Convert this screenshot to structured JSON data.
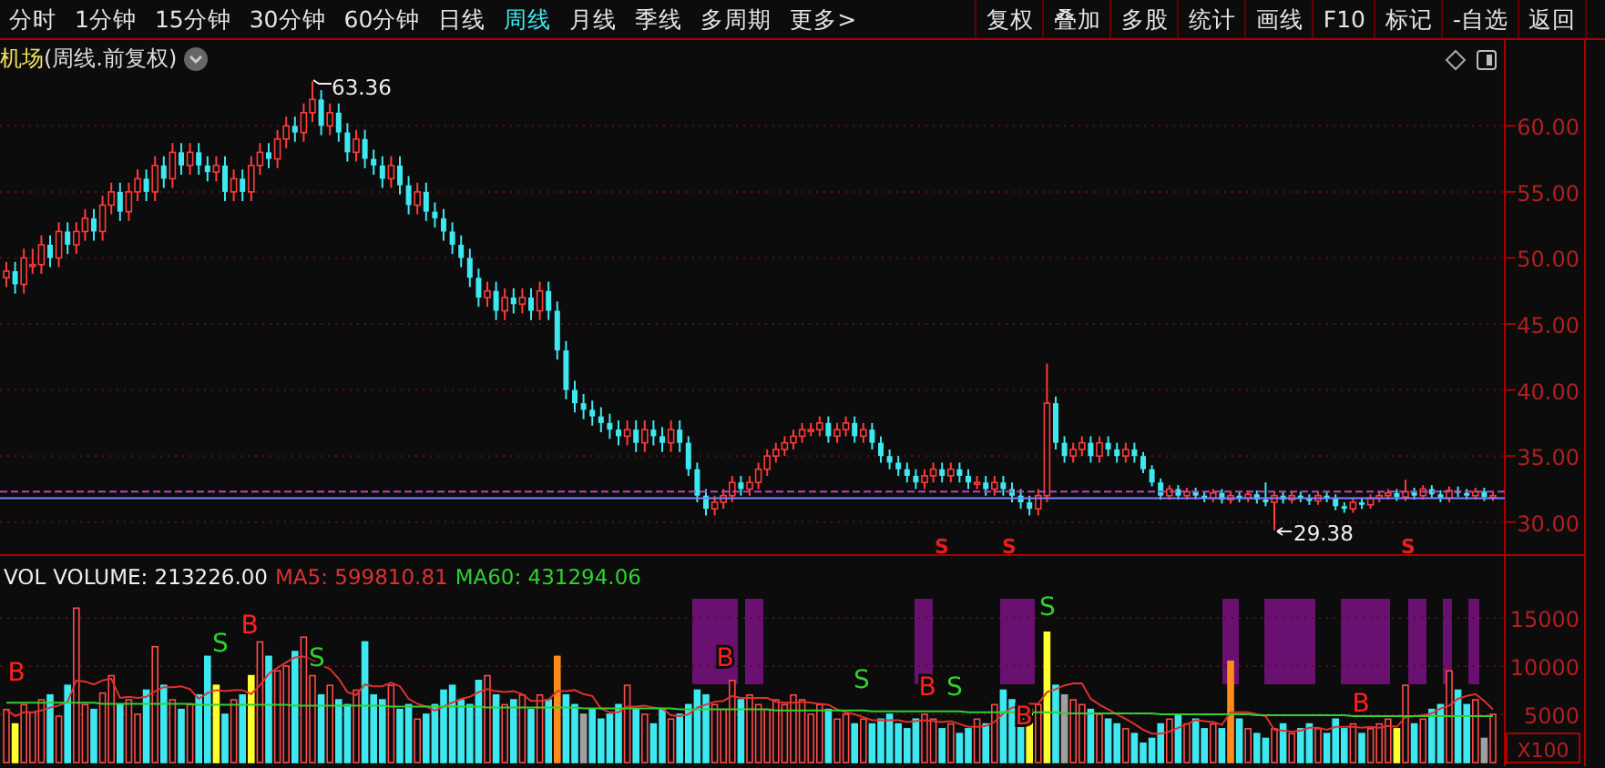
{
  "toolbar": {
    "periods": [
      {
        "label": "分时",
        "selected": false
      },
      {
        "label": "1分钟",
        "selected": false
      },
      {
        "label": "15分钟",
        "selected": false
      },
      {
        "label": "30分钟",
        "selected": false
      },
      {
        "label": "60分钟",
        "selected": false
      },
      {
        "label": "日线",
        "selected": false
      },
      {
        "label": "周线",
        "selected": true
      },
      {
        "label": "月线",
        "selected": false
      },
      {
        "label": "季线",
        "selected": false
      },
      {
        "label": "多周期",
        "selected": false
      },
      {
        "label": "更多>",
        "selected": false
      }
    ],
    "actions": [
      "复权",
      "叠加",
      "多股",
      "统计",
      "画线",
      "F10",
      "标记",
      "-自选",
      "返回"
    ]
  },
  "chart": {
    "stock_name": "机场",
    "period_label": "(周线.前复权)",
    "high_label": "63.36",
    "low_label": "29.38",
    "price_signals": [
      "S",
      "S",
      "S"
    ],
    "chart_data": {
      "type": "candlestick",
      "ylim": [
        27.5,
        66.5
      ],
      "grid": true,
      "yticks": [
        {
          "value": 60,
          "label": "60.00"
        },
        {
          "value": 55,
          "label": "55.00"
        },
        {
          "value": 50,
          "label": "50.00"
        },
        {
          "value": 45,
          "label": "45.00"
        },
        {
          "value": 40,
          "label": "40.00"
        },
        {
          "value": 35,
          "label": "35.00"
        },
        {
          "value": 30,
          "label": "30.00"
        }
      ],
      "ohlc": [
        [
          48.5,
          49.7,
          47.8,
          49
        ],
        [
          49,
          49.7,
          47.3,
          48
        ],
        [
          48,
          50.7,
          47.3,
          50
        ],
        [
          49.5,
          50.7,
          48.8,
          49.5
        ],
        [
          49.5,
          51.7,
          48.8,
          51
        ],
        [
          51,
          51.7,
          49.3,
          50
        ],
        [
          50,
          52.7,
          49.3,
          52
        ],
        [
          52,
          52.7,
          50.3,
          51
        ],
        [
          51,
          52.7,
          50.3,
          52
        ],
        [
          52,
          53.7,
          51.3,
          53
        ],
        [
          53,
          53.7,
          51.3,
          52
        ],
        [
          52,
          54.7,
          51.3,
          54
        ],
        [
          54,
          55.7,
          53.3,
          55
        ],
        [
          55,
          55.7,
          52.8,
          53.5
        ],
        [
          53.5,
          55.7,
          52.8,
          55
        ],
        [
          55,
          56.7,
          54.3,
          56
        ],
        [
          56,
          56.7,
          54.3,
          55
        ],
        [
          55,
          57.7,
          54.3,
          57
        ],
        [
          57,
          57.7,
          55.3,
          56
        ],
        [
          56,
          58.7,
          55.3,
          58
        ],
        [
          58,
          58.7,
          56.3,
          57
        ],
        [
          57,
          58.7,
          56.3,
          58
        ],
        [
          58,
          58.7,
          56.3,
          57
        ],
        [
          57,
          57.7,
          55.8,
          56.5
        ],
        [
          56.5,
          57.7,
          55.8,
          57
        ],
        [
          57,
          57.7,
          54.3,
          55
        ],
        [
          55,
          56.7,
          54.3,
          56
        ],
        [
          56,
          56.7,
          54.3,
          55
        ],
        [
          55,
          57.7,
          54.3,
          57
        ],
        [
          57,
          58.7,
          56.3,
          58
        ],
        [
          58,
          58.7,
          56.8,
          57.5
        ],
        [
          57.5,
          59.7,
          56.8,
          59
        ],
        [
          59,
          60.7,
          58.3,
          60
        ],
        [
          60,
          60.7,
          58.8,
          59.5
        ],
        [
          59.5,
          61.7,
          58.8,
          61
        ],
        [
          61,
          63.36,
          60.3,
          62
        ],
        [
          62,
          62.7,
          59.3,
          60
        ],
        [
          60,
          61.7,
          59.3,
          61
        ],
        [
          61,
          61.7,
          58.8,
          59.5
        ],
        [
          59.5,
          60.2,
          57.3,
          58
        ],
        [
          58,
          59.7,
          57.3,
          59
        ],
        [
          59,
          59.7,
          56.8,
          57.5
        ],
        [
          57.5,
          58.2,
          56.3,
          57
        ],
        [
          57,
          57.7,
          55.3,
          56
        ],
        [
          56,
          57.7,
          55.3,
          57
        ],
        [
          57,
          57.7,
          54.8,
          55.5
        ],
        [
          55.5,
          56.2,
          53.3,
          54
        ],
        [
          54,
          55.7,
          53.3,
          55
        ],
        [
          55,
          55.7,
          52.8,
          53.5
        ],
        [
          53.5,
          54.2,
          52.3,
          53
        ],
        [
          53,
          53.7,
          51.3,
          52
        ],
        [
          52,
          52.7,
          50.3,
          51
        ],
        [
          51,
          51.7,
          49.3,
          50
        ],
        [
          50,
          50.7,
          47.8,
          48.5
        ],
        [
          48.5,
          49.2,
          46.3,
          47
        ],
        [
          47,
          48.2,
          46.3,
          47.5
        ],
        [
          47.5,
          48.2,
          45.3,
          46
        ],
        [
          46,
          47.7,
          45.3,
          47
        ],
        [
          47,
          47.7,
          45.8,
          46.5
        ],
        [
          46.5,
          47.7,
          45.8,
          47
        ],
        [
          47,
          47.7,
          45.3,
          46
        ],
        [
          46,
          48.2,
          45.3,
          47.5
        ],
        [
          47.5,
          48.2,
          45.3,
          46
        ],
        [
          46,
          46.7,
          42.3,
          43
        ],
        [
          43,
          43.7,
          39.3,
          40
        ],
        [
          40,
          40.7,
          38.3,
          39
        ],
        [
          39,
          39.7,
          37.8,
          38.5
        ],
        [
          38.5,
          39.2,
          37.3,
          38
        ],
        [
          38,
          38.7,
          36.8,
          37.5
        ],
        [
          37.5,
          38.2,
          36.3,
          37
        ],
        [
          37,
          37.7,
          35.8,
          36.5
        ],
        [
          36.5,
          37.7,
          35.8,
          37
        ],
        [
          37,
          37.7,
          35.3,
          36
        ],
        [
          36,
          37.7,
          35.3,
          37
        ],
        [
          37,
          37.7,
          35.8,
          36.5
        ],
        [
          36.5,
          37.2,
          35.3,
          36
        ],
        [
          36,
          37.7,
          35.3,
          37
        ],
        [
          37,
          37.7,
          35.3,
          36
        ],
        [
          36,
          36.5,
          33.5,
          34
        ],
        [
          34,
          34.5,
          31.5,
          32
        ],
        [
          32,
          32.5,
          30.5,
          31
        ],
        [
          31,
          32,
          30.5,
          31.5
        ],
        [
          31.5,
          32.5,
          31,
          32
        ],
        [
          32,
          33.5,
          31.5,
          33
        ],
        [
          33,
          33.5,
          32,
          32.5
        ],
        [
          32.5,
          33.5,
          32,
          33
        ],
        [
          33,
          34.5,
          32.5,
          34
        ],
        [
          34,
          35.5,
          33.5,
          35
        ],
        [
          35,
          36,
          34.5,
          35.5
        ],
        [
          35.5,
          36.5,
          35,
          36
        ],
        [
          36,
          37,
          35.5,
          36.5
        ],
        [
          36.5,
          37.5,
          36,
          37
        ],
        [
          37,
          37.5,
          36.5,
          37
        ],
        [
          37,
          38,
          36.5,
          37.5
        ],
        [
          37.5,
          38,
          36,
          36.5
        ],
        [
          36.5,
          37.5,
          36,
          37
        ],
        [
          37,
          38,
          36.5,
          37.5
        ],
        [
          37.5,
          38,
          36,
          36.5
        ],
        [
          36.5,
          37.5,
          36,
          37
        ],
        [
          37,
          37.5,
          35.5,
          36
        ],
        [
          36,
          36.5,
          34.5,
          35
        ],
        [
          35,
          35.5,
          34,
          34.5
        ],
        [
          34.5,
          35,
          33.5,
          34
        ],
        [
          34,
          34.5,
          33,
          33.5
        ],
        [
          33.5,
          34,
          32.5,
          33
        ],
        [
          33,
          34,
          32.5,
          33.5
        ],
        [
          33.5,
          34.5,
          33,
          34
        ],
        [
          34,
          34.5,
          33,
          33.5
        ],
        [
          33.5,
          34.5,
          33,
          34
        ],
        [
          34,
          34.5,
          33,
          33.5
        ],
        [
          33.5,
          34,
          32.5,
          33
        ],
        [
          33,
          33.5,
          32.5,
          33
        ],
        [
          33,
          33.5,
          32,
          32.5
        ],
        [
          32.5,
          33.5,
          32,
          33
        ],
        [
          33,
          33.5,
          32,
          32.5
        ],
        [
          32.5,
          33,
          31.5,
          32
        ],
        [
          32,
          32.5,
          31,
          31.5
        ],
        [
          31.5,
          32,
          30.5,
          31
        ],
        [
          31,
          32.5,
          30.5,
          32
        ],
        [
          32,
          42,
          31.5,
          39
        ],
        [
          39,
          39.5,
          35.5,
          36
        ],
        [
          36,
          36.5,
          34.5,
          35
        ],
        [
          35,
          36,
          34.5,
          35.5
        ],
        [
          35.5,
          36.5,
          35,
          36
        ],
        [
          36,
          36.5,
          34.5,
          35
        ],
        [
          35,
          36.5,
          34.5,
          36
        ],
        [
          36,
          36.5,
          35,
          35.5
        ],
        [
          35.5,
          36,
          34.5,
          35
        ],
        [
          35,
          36,
          34.5,
          35.5
        ],
        [
          35.5,
          36,
          34.5,
          35
        ],
        [
          35,
          35.3,
          33.7,
          34
        ],
        [
          34,
          34.3,
          32.7,
          33
        ],
        [
          33,
          33.3,
          31.7,
          32
        ],
        [
          32,
          32.8,
          31.7,
          32.5
        ],
        [
          32.5,
          32.8,
          31.7,
          32
        ],
        [
          32,
          32.6,
          31.7,
          32.3
        ],
        [
          32.3,
          32.6,
          31.7,
          32
        ],
        [
          32,
          32.3,
          31.5,
          31.8
        ],
        [
          31.8,
          32.5,
          31.5,
          32.2
        ],
        [
          32.2,
          32.5,
          31.4,
          31.7
        ],
        [
          31.7,
          32.3,
          31.4,
          32
        ],
        [
          32,
          32.3,
          31.5,
          31.8
        ],
        [
          31.8,
          32.4,
          31.5,
          32.1
        ],
        [
          32.1,
          32.4,
          31.4,
          31.7
        ],
        [
          31.7,
          33,
          31.2,
          31.5
        ],
        [
          31.5,
          32.3,
          29.38,
          32
        ],
        [
          32,
          32.3,
          31.4,
          31.7
        ],
        [
          31.7,
          32.3,
          31.4,
          32
        ],
        [
          32,
          32.3,
          31.5,
          31.8
        ],
        [
          31.8,
          32.1,
          31.3,
          31.6
        ],
        [
          31.6,
          32.3,
          31.3,
          32
        ],
        [
          32,
          32.3,
          31.5,
          31.8
        ],
        [
          31.8,
          32.1,
          30.9,
          31.2
        ],
        [
          31.2,
          31.5,
          30.7,
          31
        ],
        [
          31,
          31.8,
          30.7,
          31.5
        ],
        [
          31.5,
          31.8,
          31,
          31.3
        ],
        [
          31.3,
          32.1,
          31,
          31.8
        ],
        [
          31.8,
          32.3,
          31.5,
          32
        ],
        [
          32,
          32.5,
          31.7,
          32.2
        ],
        [
          32.2,
          32.5,
          31.6,
          31.9
        ],
        [
          31.9,
          33.2,
          31.6,
          32.3
        ],
        [
          32.3,
          32.6,
          31.7,
          32
        ],
        [
          32,
          32.8,
          31.7,
          32.5
        ],
        [
          32.5,
          32.8,
          31.8,
          32.1
        ],
        [
          32.1,
          32.4,
          31.5,
          31.8
        ],
        [
          31.8,
          32.7,
          31.5,
          32.4
        ],
        [
          32.4,
          32.7,
          31.9,
          32.2
        ],
        [
          32.2,
          32.5,
          31.7,
          32
        ],
        [
          32,
          32.6,
          31.7,
          32.3
        ],
        [
          32.3,
          32.6,
          31.6,
          31.9
        ],
        [
          31.9,
          32.3,
          31.6,
          32
        ]
      ]
    }
  },
  "volume": {
    "indicator": "VOL",
    "readouts": [
      ": 213226.00",
      ": 599810.81",
      ": 431294.06"
    ],
    "unit": "X100",
    "chart_data": {
      "type": "bar",
      "ylim": [
        0,
        21500
      ],
      "grid": true,
      "stacked": false,
      "yticks": [
        {
          "value": 15000,
          "label": "15000"
        },
        {
          "value": 10000,
          "label": "10000"
        },
        {
          "value": 5000,
          "label": "5000"
        }
      ],
      "series": [
        {
          "name": "VOLUME",
          "type": "bar",
          "colors": [
            "#ff4a4a",
            "#ffff30",
            "#ff4a4a",
            "#ff4a4a",
            "#ff4a4a",
            "#3ee8f0",
            "#ff4a4a",
            "#3ee8f0",
            "#ff4a4a",
            "#ff4a4a",
            "#3ee8f0",
            "#ff4a4a",
            "#ff4a4a",
            "#3ee8f0",
            "#ff4a4a",
            "#ff4a4a",
            "#3ee8f0",
            "#ff4a4a",
            "#3ee8f0",
            "#ff4a4a",
            "#3ee8f0",
            "#ff4a4a",
            "#3ee8f0",
            "#3ee8f0",
            "#ffff30",
            "#3ee8f0",
            "#ff4a4a",
            "#3ee8f0",
            "#ffff30",
            "#ff4a4a",
            "#3ee8f0",
            "#ff4a4a",
            "#ff4a4a",
            "#3ee8f0",
            "#ff4a4a",
            "#ff4a4a",
            "#3ee8f0",
            "#ff4a4a",
            "#3ee8f0",
            "#3ee8f0",
            "#ff4a4a",
            "#3ee8f0",
            "#3ee8f0",
            "#3ee8f0",
            "#ff4a4a",
            "#3ee8f0",
            "#3ee8f0",
            "#ff4a4a",
            "#3ee8f0",
            "#3ee8f0",
            "#3ee8f0",
            "#3ee8f0",
            "#3ee8f0",
            "#3ee8f0",
            "#3ee8f0",
            "#ff4a4a",
            "#3ee8f0",
            "#ff4a4a",
            "#3ee8f0",
            "#ff4a4a",
            "#3ee8f0",
            "#ff4a4a",
            "#3ee8f0",
            "#ff8c1a",
            "#3ee8f0",
            "#3ee8f0",
            "#a0a0a0",
            "#3ee8f0",
            "#3ee8f0",
            "#3ee8f0",
            "#3ee8f0",
            "#ff4a4a",
            "#3ee8f0",
            "#ff4a4a",
            "#3ee8f0",
            "#3ee8f0",
            "#ff4a4a",
            "#3ee8f0",
            "#3ee8f0",
            "#3ee8f0",
            "#3ee8f0",
            "#ff4a4a",
            "#ff4a4a",
            "#ff4a4a",
            "#3ee8f0",
            "#ff4a4a",
            "#ff4a4a",
            "#ff4a4a",
            "#ff4a4a",
            "#ff4a4a",
            "#ff4a4a",
            "#ff4a4a",
            "#ff4a4a",
            "#ff4a4a",
            "#3ee8f0",
            "#ff4a4a",
            "#ff4a4a",
            "#3ee8f0",
            "#ff4a4a",
            "#3ee8f0",
            "#3ee8f0",
            "#3ee8f0",
            "#3ee8f0",
            "#3ee8f0",
            "#3ee8f0",
            "#ff4a4a",
            "#ff4a4a",
            "#3ee8f0",
            "#ff4a4a",
            "#3ee8f0",
            "#3ee8f0",
            "#ff4a4a",
            "#3ee8f0",
            "#ff4a4a",
            "#3ee8f0",
            "#3ee8f0",
            "#3ee8f0",
            "#ffff30",
            "#ff4a4a",
            "#ffff30",
            "#3ee8f0",
            "#a0a0a0",
            "#ff4a4a",
            "#ff4a4a",
            "#3ee8f0",
            "#ff4a4a",
            "#3ee8f0",
            "#3ee8f0",
            "#ff4a4a",
            "#3ee8f0",
            "#3ee8f0",
            "#3ee8f0",
            "#3ee8f0",
            "#ff4a4a",
            "#3ee8f0",
            "#ff4a4a",
            "#3ee8f0",
            "#3ee8f0",
            "#ff4a4a",
            "#3ee8f0",
            "#ff8c1a",
            "#3ee8f0",
            "#ff4a4a",
            "#3ee8f0",
            "#3ee8f0",
            "#ff4a4a",
            "#3ee8f0",
            "#ff4a4a",
            "#3ee8f0",
            "#3ee8f0",
            "#ff4a4a",
            "#3ee8f0",
            "#3ee8f0",
            "#3ee8f0",
            "#ff4a4a",
            "#3ee8f0",
            "#ff4a4a",
            "#ff4a4a",
            "#ff4a4a",
            "#ffff30",
            "#ff4a4a",
            "#3ee8f0",
            "#ff4a4a",
            "#3ee8f0",
            "#3ee8f0",
            "#ff4a4a",
            "#3ee8f0",
            "#3ee8f0",
            "#ff4a4a",
            "#a0a0a0",
            "#ff4a4a"
          ],
          "values": [
            5500,
            4000,
            6000,
            5200,
            6500,
            7000,
            4800,
            8000,
            16000,
            6000,
            5500,
            7200,
            9000,
            6000,
            6500,
            5000,
            7500,
            12000,
            8000,
            6500,
            5500,
            6000,
            7000,
            11000,
            8000,
            5000,
            6500,
            7000,
            9000,
            12500,
            11000,
            9500,
            10000,
            11500,
            13000,
            9000,
            7000,
            8000,
            6500,
            6000,
            7500,
            12500,
            7000,
            6500,
            8000,
            5500,
            6000,
            4500,
            5000,
            6000,
            7500,
            8000,
            6500,
            6000,
            8500,
            9000,
            7000,
            6000,
            6500,
            7000,
            5500,
            7000,
            6500,
            11000,
            7000,
            6000,
            5000,
            5500,
            4500,
            5000,
            6000,
            8000,
            5500,
            5000,
            4000,
            5500,
            4500,
            5000,
            6000,
            7500,
            7000,
            6000,
            5500,
            8500,
            6500,
            7000,
            6000,
            5500,
            6500,
            6000,
            7000,
            6500,
            5000,
            6000,
            5500,
            4500,
            5000,
            4000,
            4500,
            4000,
            4500,
            5000,
            4000,
            3500,
            4500,
            5000,
            4500,
            3500,
            4000,
            3000,
            3500,
            4500,
            4000,
            6000,
            7500,
            6500,
            5000,
            5500,
            6000,
            13500,
            8000,
            7000,
            6500,
            6000,
            5500,
            5000,
            4500,
            4000,
            3500,
            3000,
            2000,
            2500,
            4000,
            4500,
            5000,
            4000,
            4500,
            3500,
            4000,
            3500,
            10500,
            4500,
            3500,
            3000,
            2500,
            3500,
            4000,
            3000,
            3500,
            4000,
            3500,
            3000,
            4500,
            3500,
            4000,
            3000,
            3500,
            4000,
            4500,
            3500,
            8000,
            4000,
            4500,
            5500,
            6000,
            9500,
            7500,
            6000,
            6500,
            2500,
            5000
          ]
        },
        {
          "name": "MA5",
          "type": "line",
          "color": "#e03030",
          "values": [
            5500,
            4800,
            5200,
            5200,
            5400,
            5700,
            5900,
            6300,
            8500,
            8400,
            8100,
            8500,
            8700,
            6700,
            6800,
            6700,
            6800,
            7400,
            7800,
            7800,
            7900,
            7600,
            6600,
            7200,
            7500,
            7400,
            7500,
            7500,
            7100,
            8000,
            9200,
            9800,
            10400,
            10900,
            11000,
            10600,
            10100,
            9700,
            8700,
            7300,
            7000,
            8100,
            7900,
            7900,
            8300,
            7900,
            6600,
            6100,
            5800,
            5400,
            5800,
            6200,
            6600,
            6800,
            7300,
            7600,
            7400,
            7300,
            7400,
            7100,
            6400,
            6400,
            6500,
            7400,
            7400,
            7500,
            7100,
            6900,
            5600,
            5200,
            5200,
            5800,
            5800,
            5900,
            5700,
            5600,
            4900,
            4800,
            5000,
            5700,
            6000,
            6300,
            6400,
            6900,
            6700,
            6700,
            6700,
            6700,
            6300,
            6200,
            6200,
            6300,
            6200,
            6100,
            6000,
            5500,
            5200,
            5000,
            4700,
            4400,
            4400,
            4400,
            4400,
            4200,
            4300,
            4400,
            4300,
            4200,
            4300,
            4000,
            3700,
            3700,
            3800,
            4200,
            5100,
            5700,
            5800,
            6100,
            6100,
            7300,
            7600,
            8000,
            8200,
            8200,
            6600,
            6000,
            5500,
            5000,
            4500,
            4000,
            3400,
            3000,
            3000,
            3200,
            3600,
            4000,
            4400,
            4300,
            4200,
            3900,
            5200,
            5200,
            5200,
            5000,
            4800,
            3400,
            3300,
            3200,
            3300,
            3600,
            3600,
            3400,
            3700,
            3700,
            3700,
            3600,
            3700,
            3600,
            3800,
            3700,
            4700,
            4800,
            4900,
            5100,
            5600,
            5900,
            6600,
            6900,
            7100,
            6400,
            5500
          ]
        },
        {
          "name": "MA60",
          "type": "line",
          "color": "#30d030",
          "values": [
            6200,
            6200,
            6200,
            6200,
            6200,
            6200,
            6200,
            6200,
            6200,
            6200,
            6200,
            6100,
            6100,
            6100,
            6100,
            6100,
            6100,
            6100,
            6100,
            6100,
            6100,
            6100,
            6000,
            6000,
            6000,
            6000,
            6000,
            6000,
            6000,
            6000,
            6000,
            6000,
            6000,
            5900,
            5900,
            5900,
            5900,
            5900,
            5900,
            5900,
            5900,
            5900,
            5900,
            5900,
            5800,
            5800,
            5800,
            5800,
            5800,
            5800,
            5800,
            5800,
            5800,
            5800,
            5800,
            5700,
            5700,
            5700,
            5700,
            5700,
            5700,
            5700,
            5700,
            5700,
            5700,
            5700,
            5600,
            5600,
            5600,
            5600,
            5600,
            5600,
            5600,
            5600,
            5600,
            5600,
            5600,
            5500,
            5500,
            5500,
            5500,
            5500,
            5500,
            5500,
            5500,
            5500,
            5500,
            5500,
            5400,
            5400,
            5400,
            5400,
            5400,
            5400,
            5400,
            5400,
            5400,
            5400,
            5400,
            5300,
            5300,
            5300,
            5300,
            5300,
            5300,
            5300,
            5300,
            5300,
            5300,
            5300,
            5200,
            5200,
            5200,
            5200,
            5200,
            5200,
            5200,
            5200,
            5200,
            5200,
            5200,
            5100,
            5100,
            5100,
            5100,
            5100,
            5100,
            5100,
            5100,
            5100,
            5100,
            5100,
            5000,
            5000,
            5000,
            5000,
            5000,
            5000,
            5000,
            5000,
            5000,
            5000,
            5000,
            4900,
            4900,
            4900,
            4900,
            4900,
            4900,
            4900,
            4900,
            4900,
            4900,
            4900,
            4800,
            4800,
            4800,
            4800,
            4800,
            4800,
            4800,
            4800,
            4800,
            4800,
            4800,
            4800,
            4800,
            4800,
            4800,
            4800,
            4800
          ]
        }
      ]
    },
    "signals": [
      {
        "text": "B",
        "kind": "buy"
      },
      {
        "text": "S",
        "kind": "sell"
      },
      {
        "text": "B",
        "kind": "buy"
      },
      {
        "text": "S",
        "kind": "sell"
      },
      {
        "text": "B",
        "kind": "buy"
      },
      {
        "text": "S",
        "kind": "sell"
      },
      {
        "text": "B",
        "kind": "buy"
      },
      {
        "text": "S",
        "kind": "sell"
      },
      {
        "text": "B",
        "kind": "buy"
      },
      {
        "text": "S",
        "kind": "sell"
      },
      {
        "text": "B",
        "kind": "buy"
      }
    ]
  }
}
